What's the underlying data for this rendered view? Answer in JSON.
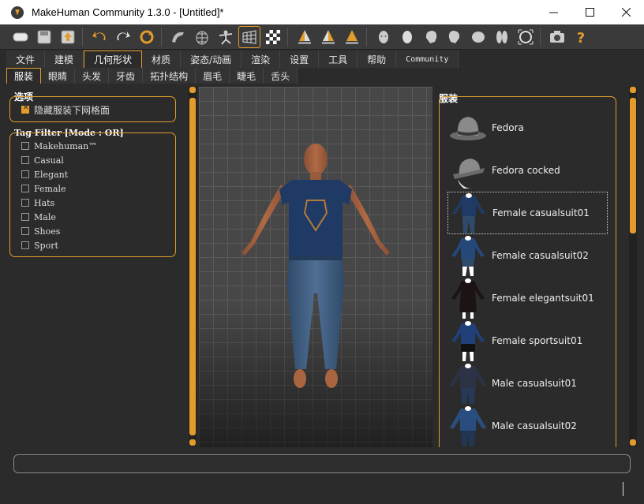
{
  "window": {
    "title": "MakeHuman Community 1.3.0 - [Untitled]*",
    "controls": {
      "minimize": "—",
      "maximize": "☐",
      "close": "✕"
    }
  },
  "toolbar": {
    "groups": [
      [
        "new-icon",
        "save-icon",
        "export-icon"
      ],
      [
        "undo-icon",
        "redo-icon",
        "reset-icon"
      ],
      [
        "smooth-icon",
        "wireframe-icon",
        "pose-icon",
        "grid-icon",
        "checker-icon"
      ],
      [
        "front-view-icon",
        "side-view-icon",
        "back-view-icon"
      ],
      [
        "face-icon",
        "head-icon",
        "profile-left-icon",
        "profile-right-icon",
        "top-icon",
        "legs-icon",
        "reset-camera-icon"
      ],
      [
        "screenshot-icon",
        "help-icon"
      ]
    ],
    "active": "grid-icon",
    "accent": "#e39b2b"
  },
  "tabs": {
    "main": [
      "文件",
      "建模",
      "几何形状",
      "材质",
      "姿态/动画",
      "渲染",
      "设置",
      "工具",
      "帮助",
      "Community"
    ],
    "main_active": "几何形状",
    "sub": [
      "服装",
      "眼睛",
      "头发",
      "牙齿",
      "拓扑结构",
      "眉毛",
      "睫毛",
      "舌头"
    ],
    "sub_active": "服装"
  },
  "left": {
    "options_title": "选项",
    "hide_mesh_label": "隐藏服装下网格面",
    "hide_mesh_checked": true,
    "tag_filter_title": "Tag Filter [Mode : OR]",
    "tags": [
      "Makehuman™",
      "Casual",
      "Elegant",
      "Female",
      "Hats",
      "Male",
      "Shoes",
      "Sport"
    ]
  },
  "right": {
    "title": "服装",
    "items": [
      {
        "label": "Fedora",
        "icon": "fedora-hat-icon",
        "selected": false
      },
      {
        "label": "Fedora cocked",
        "icon": "fedora-cocked-icon",
        "selected": false
      },
      {
        "label": "Female casualsuit01",
        "icon": "female-casualsuit01-icon",
        "selected": true
      },
      {
        "label": "Female casualsuit02",
        "icon": "female-casualsuit02-icon",
        "selected": false
      },
      {
        "label": "Female elegantsuit01",
        "icon": "female-elegantsuit01-icon",
        "selected": false
      },
      {
        "label": "Female sportsuit01",
        "icon": "female-sportsuit01-icon",
        "selected": false
      },
      {
        "label": "Male casualsuit01",
        "icon": "male-casualsuit01-icon",
        "selected": false
      },
      {
        "label": "Male casualsuit02",
        "icon": "male-casualsuit02-icon",
        "selected": false
      }
    ]
  }
}
